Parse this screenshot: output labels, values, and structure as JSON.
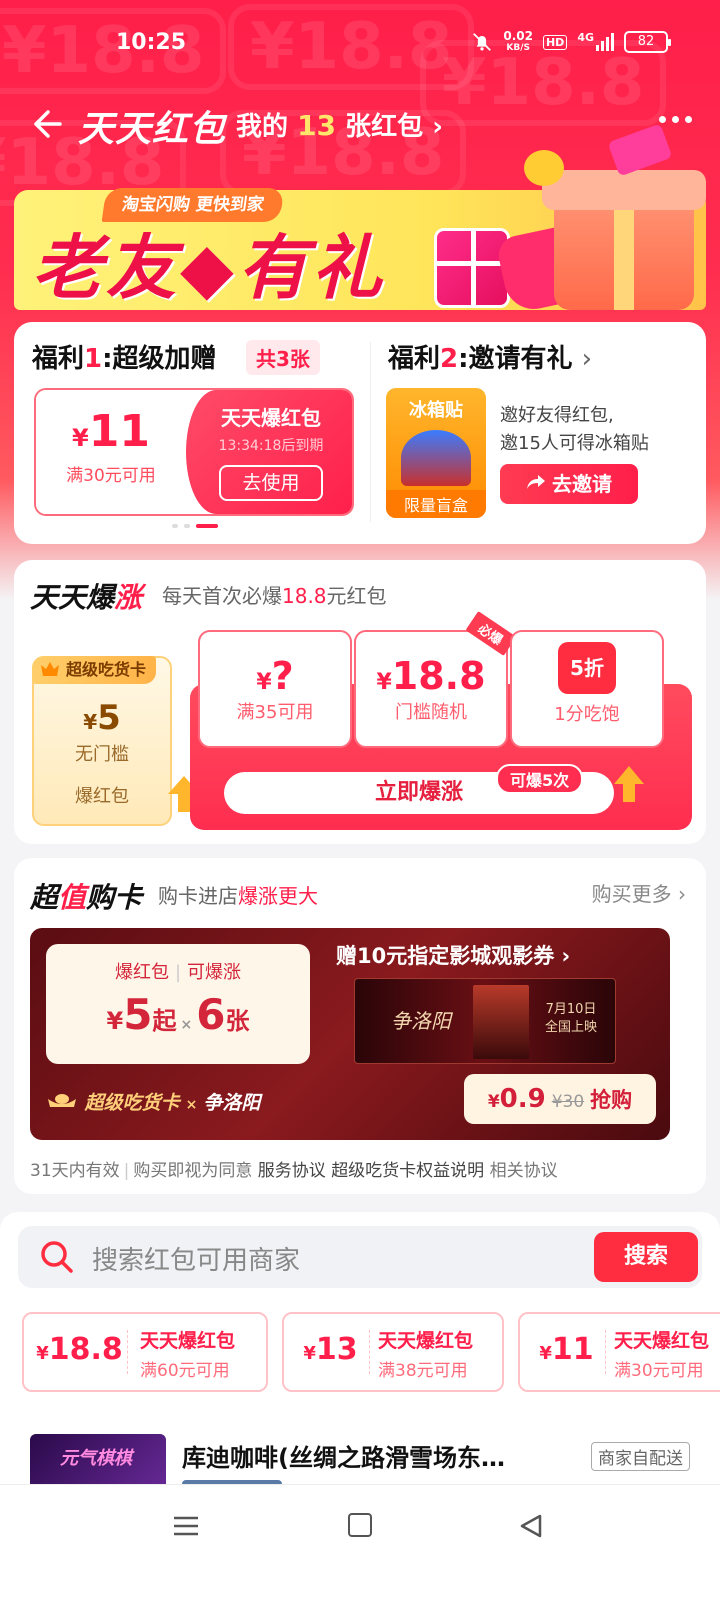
{
  "status_bar": {
    "time": "10:25",
    "net_speed": "0.02",
    "net_unit": "KB/S",
    "hd": "HD",
    "network": "4G",
    "battery": "82"
  },
  "header": {
    "title": "天天红包",
    "my_packets_prefix": "我的",
    "my_packets_count": "13",
    "my_packets_suffix": "张红包",
    "chevron": "›"
  },
  "banner": {
    "tag": "淘宝闪购  更快到家",
    "title": "老友◆有礼",
    "bg_pattern": "¥18.8"
  },
  "welfare": {
    "w1_prefix": "福利",
    "w1_num": "1",
    "w1_title": ":超级加赠",
    "w1_count": "共3张",
    "coupon": {
      "currency": "¥",
      "amount": "11",
      "condition": "满30元可用",
      "name": "天天爆红包",
      "expire": "13:34:18后到期",
      "button": "去使用"
    },
    "w2_prefix": "福利",
    "w2_num": "2",
    "w2_title": ":邀请有礼",
    "w2_chevron": "›",
    "fridge_title": "冰箱贴",
    "fridge_bottom": "限量盲盒",
    "invite_line1": "邀好友得红包,",
    "invite_line2": "邀15人可得冰箱贴",
    "invite_button": "去邀请"
  },
  "daily": {
    "logo_a": "天天爆",
    "logo_b": "涨",
    "sub_a": "每天首次必爆",
    "sub_b": "18.8",
    "sub_c": "元红包",
    "foodie": {
      "tag": "超级吃货卡",
      "currency": "¥",
      "amount": "5",
      "condition": "无门槛",
      "label": "爆红包"
    },
    "items": [
      {
        "currency": "¥",
        "amount": "?",
        "condition": "满35可用"
      },
      {
        "currency": "¥",
        "amount": "18.8",
        "condition": "门槛随机",
        "ribbon": "必爆"
      },
      {
        "badge": "5折",
        "condition": "1分吃饱"
      }
    ],
    "button": "立即爆涨",
    "times": "可爆5次"
  },
  "super_card": {
    "logo_a": "超",
    "logo_b": "值",
    "logo_c": "购卡",
    "sub_a": "购卡进店",
    "sub_b": "爆涨更大",
    "more": "购买更多 ›",
    "info_l1a": "爆红包",
    "info_sep": "|",
    "info_l1b": "可爆涨",
    "info_currency": "¥",
    "info_from": "5",
    "info_from_suffix": "起",
    "info_x": "×",
    "info_count": "6",
    "info_count_suffix": "张",
    "gift": "赠10元指定影城观影券 ›",
    "movie_title": "争洛阳",
    "movie_date_l1": "7月10日",
    "movie_date_l2": "全国上映",
    "brand": "超级吃货卡",
    "brand_x": "×",
    "brand_movie": "争洛阳",
    "price_currency": "¥",
    "price": "0.9",
    "old_price": "¥30",
    "buy": "抢购",
    "terms_a": "31天内有效",
    "terms_b": "购买即视为同意",
    "terms_c": "服务协议",
    "terms_d": "超级吃货卡权益说明",
    "terms_e": "相关协议"
  },
  "search": {
    "placeholder": "搜索红包可用商家",
    "button": "搜索"
  },
  "mini_coupons": [
    {
      "currency": "¥",
      "amount": "18.8",
      "name": "天天爆红包",
      "condition": "满60元可用"
    },
    {
      "currency": "¥",
      "amount": "13",
      "name": "天天爆红包",
      "condition": "满38元可用"
    },
    {
      "currency": "¥",
      "amount": "11",
      "name": "天天爆红包",
      "condition": "满30元可用"
    }
  ],
  "store": {
    "thumb_text": "元气棋棋",
    "name": "库迪咖啡(丝绸之路滑雪场东…",
    "tag": "商家自配送"
  },
  "colors": {
    "brand_red": "#ff1f4a",
    "banner_yellow": "#fff27a",
    "gold": "#ffcf7a"
  }
}
